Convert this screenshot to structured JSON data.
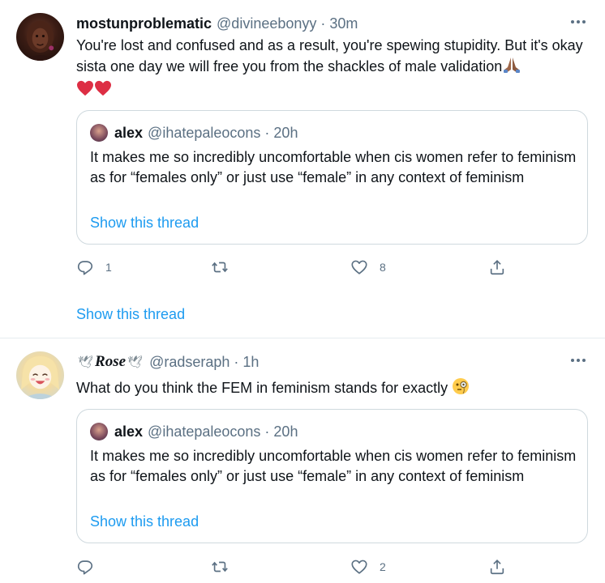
{
  "tweets": [
    {
      "author_name": "mostunproblematic",
      "handle": "@divineebonyy",
      "separator": "·",
      "time": "30m",
      "text": "You're lost and confused and as a result, you're spewing stupidity. But it's okay sista one day we will free you from the shackles of male validation",
      "quote": {
        "author_name": "alex",
        "handle": "@ihatepaleocons",
        "separator": "·",
        "time": "20h",
        "text": "It makes me so incredibly uncomfortable when cis women refer to feminism as for “females only” or just use “female” in any context of feminism",
        "show_thread": "Show this thread"
      },
      "reply_count": "1",
      "like_count": "8",
      "show_thread": "Show this thread"
    },
    {
      "author_name": "Rose",
      "handle": "@radseraph",
      "separator": "·",
      "time": "1h",
      "name_decor_left": "🕊",
      "name_decor_right": "🕊",
      "text": "What do you think the FEM in feminism stands for exactly",
      "quote": {
        "author_name": "alex",
        "handle": "@ihatepaleocons",
        "separator": "·",
        "time": "20h",
        "text": "It makes me so incredibly uncomfortable when cis women refer to feminism as for “females only” or just use “female” in any context of feminism",
        "show_thread": "Show this thread"
      },
      "reply_count": "",
      "like_count": "2"
    }
  ],
  "colors": {
    "link": "#1d9bf0",
    "muted": "#5b7083",
    "border": "#cfd9de",
    "heart": "#e0245e"
  },
  "icons": [
    "more-icon",
    "reply-icon",
    "retweet-icon",
    "like-icon",
    "share-icon",
    "praying-hands-icon",
    "heart-icon",
    "monocle-face-icon",
    "dove-icon"
  ]
}
